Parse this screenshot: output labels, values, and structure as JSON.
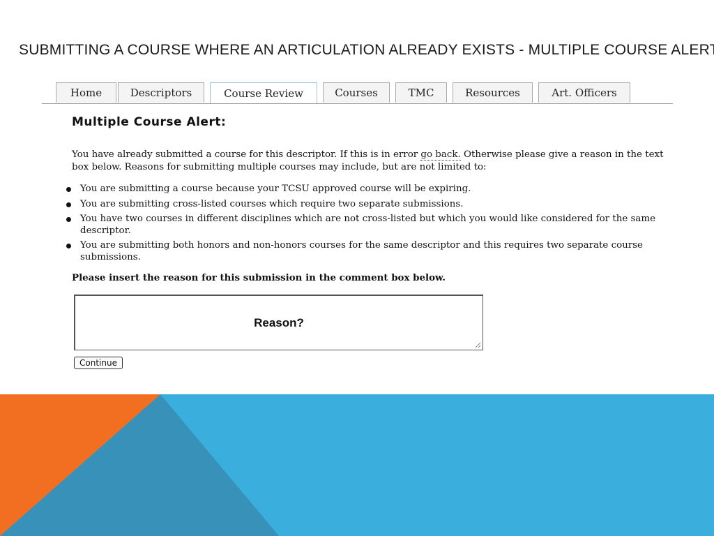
{
  "slide": {
    "title": "SUBMITTING A COURSE WHERE AN ARTICULATION ALREADY EXISTS - MULTIPLE COURSE ALERT"
  },
  "nav": {
    "tabs": [
      {
        "label": "Home"
      },
      {
        "label": "Descriptors"
      },
      {
        "label": "Course Review",
        "active": true
      },
      {
        "label": "Courses"
      },
      {
        "label": "TMC"
      },
      {
        "label": "Resources"
      },
      {
        "label": "Art. Officers"
      }
    ]
  },
  "alert": {
    "title": "Multiple Course Alert:",
    "intro_before_link": "You have already submitted a course for this descriptor. If this is in error ",
    "link": "go back.",
    "intro_after_link": " Otherwise please give a reason in the text box below. Reasons for submitting multiple courses may include, but are not limited to:",
    "reasons": [
      "You are submitting a course because your TCSU approved course will be expiring.",
      "You are submitting cross-listed courses which require two separate submissions.",
      "You have two courses in different disciplines which are not cross-listed but which you would like considered for the same descriptor.",
      "You are submitting both honors and non-honors courses for the same descriptor and this requires two separate course submissions."
    ],
    "instruction": "Please insert the reason for this submission in the comment box below.",
    "comment_value": "Reason?",
    "continue_label": "Continue"
  },
  "colors": {
    "orange": "#f26f21",
    "blue": "#3aaedd",
    "teal": "#3891b8"
  }
}
